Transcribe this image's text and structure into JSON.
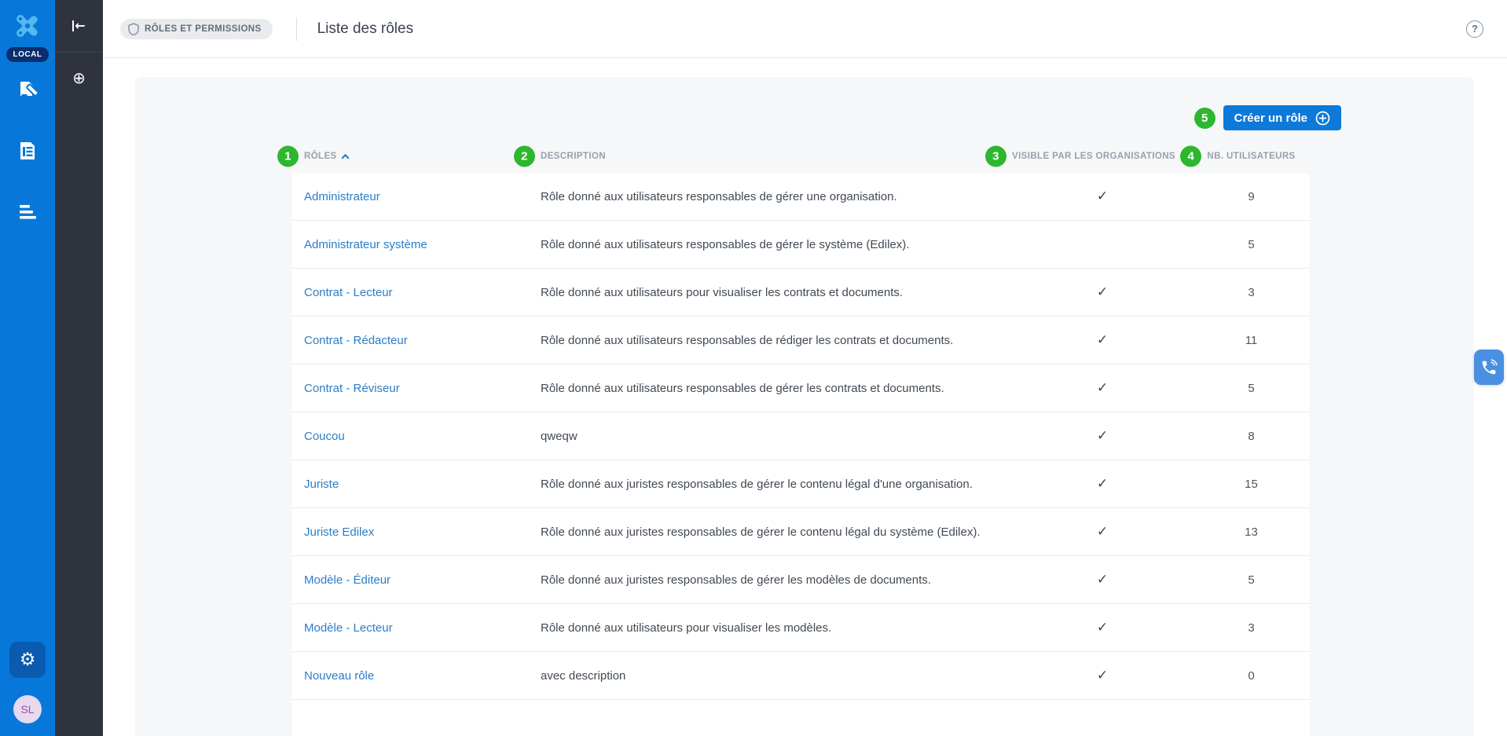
{
  "colors": {
    "sidebar_blue": "#0778d9",
    "sidebar_dark": "#2f333e",
    "active_item_bg": "#0a5bb0",
    "env_badge_bg": "#0a2e6e",
    "logo_blue": "#53b9ee",
    "link_blue": "#2b7dc6",
    "button_blue": "#0d79d9",
    "annotation_green": "#2eb72e",
    "card_bg": "#f6f7f9",
    "avatar_bg": "#e8d9f0",
    "avatar_text": "#8a56a8",
    "phone_tab_blue": "#4a90e2"
  },
  "sidebar": {
    "env_badge": "LOCAL",
    "avatar_initials": "SL",
    "items": [
      {
        "name": "contracts"
      },
      {
        "name": "documents"
      },
      {
        "name": "clauses-list"
      }
    ],
    "settings_active": true
  },
  "icons": {
    "logo": "x-cross-mark",
    "collapse": "arrow-to-bar-left",
    "collapse_glyph": "←",
    "add_glyph": "⊕",
    "shield": "shield-outline",
    "help_glyph": "?",
    "sort": "chevron-up",
    "create_plus": "plus-circle",
    "gear_glyph": "⚙",
    "check_glyph": "✓",
    "phone": "phone-call"
  },
  "header": {
    "breadcrumb": "RÔLES ET PERMISSIONS",
    "title": "Liste des rôles"
  },
  "toolbar": {
    "create_button_label": "Créer un rôle"
  },
  "annotations": [
    "1",
    "2",
    "3",
    "4",
    "5"
  ],
  "table": {
    "columns": [
      "RÔLES",
      "DESCRIPTION",
      "VISIBLE PAR LES ORGANISATIONS",
      "NB. UTILISATEURS"
    ],
    "sorted_column": "RÔLES",
    "sort_direction": "asc",
    "rows": [
      {
        "role": "Administrateur",
        "description": "Rôle donné aux utilisateurs responsables de gérer une organisation.",
        "visible": true,
        "users": "9"
      },
      {
        "role": "Administrateur système",
        "description": "Rôle donné aux utilisateurs responsables de gérer le système (Edilex).",
        "visible": false,
        "users": "5"
      },
      {
        "role": "Contrat - Lecteur",
        "description": "Rôle donné aux utilisateurs pour visualiser les contrats et documents.",
        "visible": true,
        "users": "3"
      },
      {
        "role": "Contrat - Rédacteur",
        "description": "Rôle donné aux utilisateurs responsables de rédiger les contrats et documents.",
        "visible": true,
        "users": "11"
      },
      {
        "role": "Contrat - Réviseur",
        "description": "Rôle donné aux utilisateurs responsables de gérer les contrats et documents.",
        "visible": true,
        "users": "5"
      },
      {
        "role": "Coucou",
        "description": "qweqw",
        "visible": true,
        "users": "8"
      },
      {
        "role": "Juriste",
        "description": "Rôle donné aux juristes responsables de gérer le contenu légal d'une organisation.",
        "visible": true,
        "users": "15"
      },
      {
        "role": "Juriste Edilex",
        "description": "Rôle donné aux juristes responsables de gérer le contenu légal du système (Edilex).",
        "visible": true,
        "users": "13"
      },
      {
        "role": "Modèle - Éditeur",
        "description": "Rôle donné aux juristes responsables de gérer les modèles de documents.",
        "visible": true,
        "users": "5"
      },
      {
        "role": "Modèle - Lecteur",
        "description": "Rôle donné aux utilisateurs pour visualiser les modèles.",
        "visible": true,
        "users": "3"
      },
      {
        "role": "Nouveau rôle",
        "description": "avec description",
        "visible": true,
        "users": "0"
      }
    ]
  }
}
